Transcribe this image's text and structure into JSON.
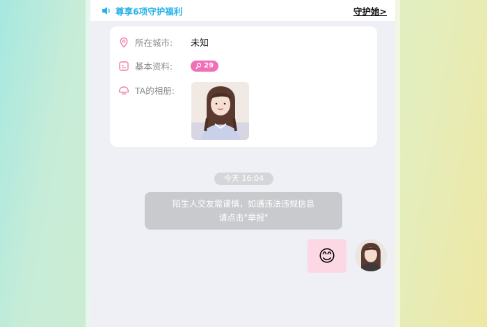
{
  "topbar": {
    "guard_text": "尊享6项守护福利",
    "guard_link": "守护她>"
  },
  "profile": {
    "city_label": "所在城市:",
    "city_value": "未知",
    "info_label": "基本资料:",
    "info_badge": "29",
    "album_label": "TA的相册:"
  },
  "chat": {
    "time": "今天 16:04",
    "notice_line1": "陌生人交友需谨慎，如遇违法违规信息",
    "notice_line2": "请点击\"举报\"",
    "my_message_emoji": "😊"
  },
  "colors": {
    "accent_blue": "#26b2e8",
    "accent_pink": "#f06fb6"
  },
  "icons": [
    "speaker-icon",
    "location-icon",
    "profile-icon",
    "album-icon",
    "female-icon"
  ]
}
